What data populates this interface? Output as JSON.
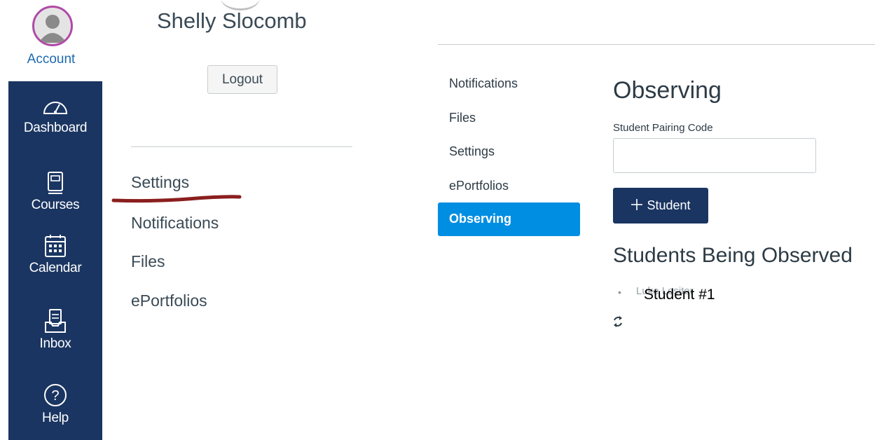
{
  "global_nav": {
    "account_label": "Account",
    "items": [
      {
        "label": "Dashboard",
        "icon": "dashboard-icon"
      },
      {
        "label": "Courses",
        "icon": "courses-icon"
      },
      {
        "label": "Calendar",
        "icon": "calendar-icon"
      },
      {
        "label": "Inbox",
        "icon": "inbox-icon"
      },
      {
        "label": "Help",
        "icon": "help-icon"
      }
    ],
    "colors": {
      "background": "#1a3561",
      "account_text": "#1c6ab2",
      "avatar_ring": "#b04aa6"
    }
  },
  "profile": {
    "name": "Shelly Slocomb",
    "logout_label": "Logout",
    "links": [
      "Settings",
      "Notifications",
      "Files",
      "ePortfolios"
    ]
  },
  "account_nav": {
    "items": [
      "Notifications",
      "Files",
      "Settings",
      "ePortfolios",
      "Observing"
    ],
    "active": "Observing",
    "active_color": "#008ee2"
  },
  "observing": {
    "title": "Observing",
    "pairing_code_label": "Student Pairing Code",
    "pairing_code_value": "",
    "add_student_label": "Student",
    "add_student_icon": "plus-icon",
    "button_color": "#1a3561",
    "students_heading": "Students Being Observed",
    "students": [
      {
        "name_under": "Luke Lesiter",
        "name_overlay": "Student #1"
      }
    ],
    "refresh_icon": "refresh-icon"
  },
  "annotation_color": "#8b1e1e"
}
